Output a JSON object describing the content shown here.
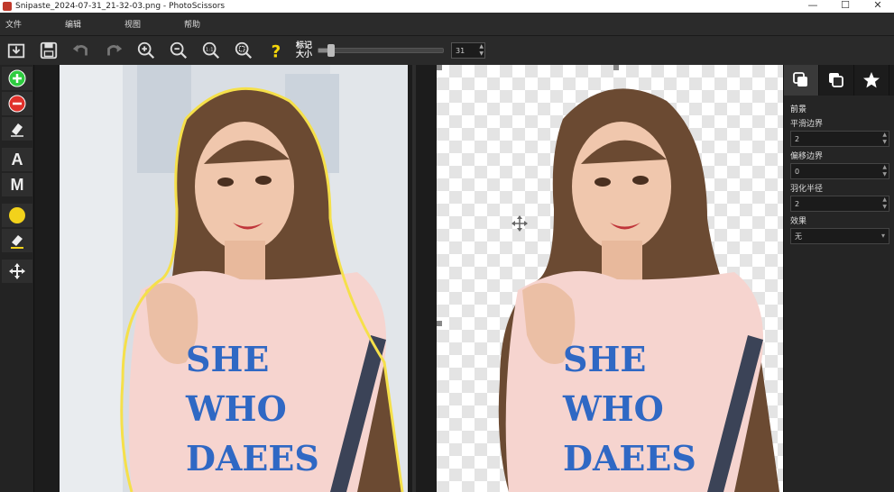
{
  "window": {
    "title": "Snipaste_2024-07-31_21-32-03.png - PhotoScissors",
    "minimize": "—",
    "maximize": "☐",
    "close": "✕"
  },
  "menu": [
    "文件",
    "编辑",
    "视图",
    "帮助"
  ],
  "toolbar": {
    "mark_size_label_line1": "标记",
    "mark_size_label_line2": "大小",
    "mark_size_value": "31",
    "mark_size_fraction": 0.1
  },
  "left_tools": {
    "text_a": "A",
    "text_m": "M"
  },
  "colors": {
    "add_green": "#2ecc40",
    "remove_red": "#e0302a",
    "foreground_yellow": "#f2d21b",
    "outline_yellow": "#f5e04a",
    "help_yellow": "#f5d60a",
    "shirt_text_blue": "#2f68c4"
  },
  "shirt_text": [
    "SHE",
    "WHO",
    "DAEES"
  ],
  "right_panel": {
    "section": "前景",
    "fields": [
      {
        "label": "平滑边界",
        "value": "2"
      },
      {
        "label": "偏移边界",
        "value": "0"
      },
      {
        "label": "羽化半径",
        "value": "2"
      }
    ],
    "effect_label": "效果",
    "effect_value": "无"
  }
}
